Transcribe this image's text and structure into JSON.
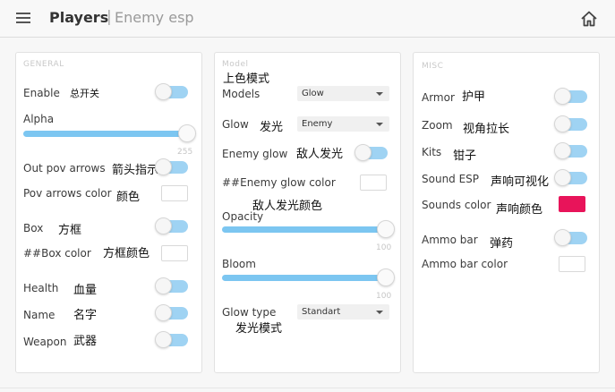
{
  "header": {
    "title": "Players",
    "separator": "|",
    "subtitle": "Enemy esp"
  },
  "icons": {
    "menu": "hamburger-icon",
    "home": "home-icon"
  },
  "colors": {
    "toggle": "#9fd3f3",
    "slider": "#7cc6f1",
    "sounds_color": "#e8145a"
  },
  "general": {
    "title": "GENERAL",
    "enable": {
      "label": "Enable",
      "cn": "总开关"
    },
    "alpha": {
      "label": "Alpha",
      "value": "255"
    },
    "out_pov_arrows": {
      "label": "Out pov arrows",
      "cn": "箭头指示"
    },
    "pov_arrows_color": {
      "label": "Pov arrows color",
      "cn": "颜色"
    },
    "box": {
      "label": "Box",
      "cn": "方框"
    },
    "box_color": {
      "label": "##Box color",
      "cn": "方框颜色"
    },
    "health": {
      "label": "Health",
      "cn": "血量"
    },
    "name": {
      "label": "Name",
      "cn": "名字"
    },
    "weapon": {
      "label": "Weapon",
      "cn": "武器"
    }
  },
  "model": {
    "title": "Model",
    "title_cn": "上色模式",
    "models": {
      "label": "Models",
      "selected": "Glow"
    },
    "glow": {
      "label": "Glow",
      "cn": "发光",
      "selected": "Enemy"
    },
    "enemy_glow": {
      "label": "Enemy glow",
      "cn": "敌人发光"
    },
    "enemy_glow_color": {
      "label": "##Enemy glow color",
      "cn": "敌人发光颜色"
    },
    "opacity": {
      "label": "Opacity",
      "value": "100"
    },
    "bloom": {
      "label": "Bloom",
      "value": "100"
    },
    "glow_type": {
      "label": "Glow type",
      "cn": "发光模式",
      "selected": "Standart"
    }
  },
  "misc": {
    "title": "MISC",
    "armor": {
      "label": "Armor",
      "cn": "护甲"
    },
    "zoom": {
      "label": "Zoom",
      "cn": "视角拉长"
    },
    "kits": {
      "label": "Kits",
      "cn": "钳子"
    },
    "sound_esp": {
      "label": "Sound ESP",
      "cn": "声响可视化"
    },
    "sounds_color": {
      "label": "Sounds color",
      "cn": "声响颜色"
    },
    "ammo_bar": {
      "label": "Ammo bar",
      "cn": "弹药"
    },
    "ammo_bar_color": {
      "label": "Ammo bar color"
    }
  }
}
